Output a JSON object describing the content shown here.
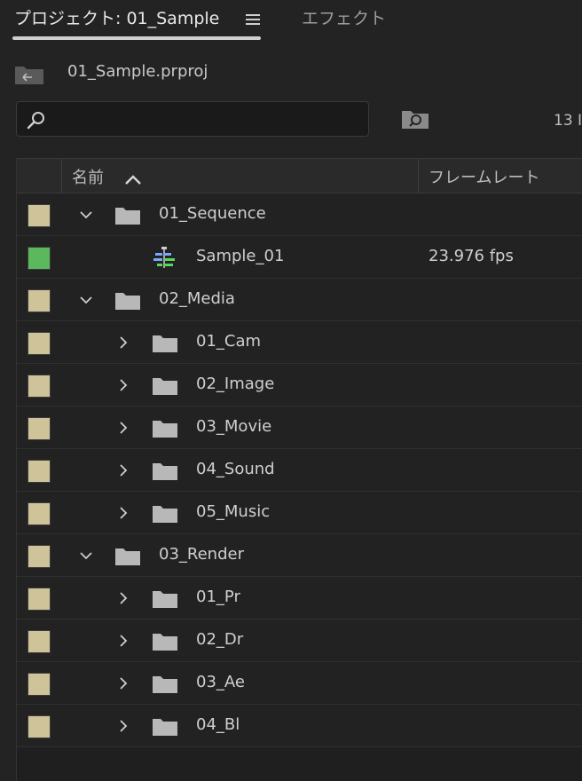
{
  "tabs": {
    "project_label": "プロジェクト: 01_Sample",
    "effects_label": "エフェクト"
  },
  "project": {
    "file_name": "01_Sample.prproj"
  },
  "search": {
    "value": "",
    "placeholder": ""
  },
  "item_count": "13 I",
  "columns": {
    "name": "名前",
    "frame_rate": "フレームレート"
  },
  "colors": {
    "folder_swatch": "#cfc39a",
    "sequence_swatch": "#5cb85c",
    "folder_icon": "#b8b8b8"
  },
  "rows": [
    {
      "label": "01_Sequence",
      "type": "bin",
      "expanded": true,
      "depth": 0,
      "rate": ""
    },
    {
      "label": "Sample_01",
      "type": "sequence",
      "expanded": false,
      "depth": 1,
      "rate": "23.976 fps"
    },
    {
      "label": "02_Media",
      "type": "bin",
      "expanded": true,
      "depth": 0,
      "rate": ""
    },
    {
      "label": "01_Cam",
      "type": "bin",
      "expanded": false,
      "depth": 1,
      "rate": ""
    },
    {
      "label": "02_Image",
      "type": "bin",
      "expanded": false,
      "depth": 1,
      "rate": ""
    },
    {
      "label": "03_Movie",
      "type": "bin",
      "expanded": false,
      "depth": 1,
      "rate": ""
    },
    {
      "label": "04_Sound",
      "type": "bin",
      "expanded": false,
      "depth": 1,
      "rate": ""
    },
    {
      "label": "05_Music",
      "type": "bin",
      "expanded": false,
      "depth": 1,
      "rate": ""
    },
    {
      "label": "03_Render",
      "type": "bin",
      "expanded": true,
      "depth": 0,
      "rate": ""
    },
    {
      "label": "01_Pr",
      "type": "bin",
      "expanded": false,
      "depth": 1,
      "rate": ""
    },
    {
      "label": "02_Dr",
      "type": "bin",
      "expanded": false,
      "depth": 1,
      "rate": ""
    },
    {
      "label": "03_Ae",
      "type": "bin",
      "expanded": false,
      "depth": 1,
      "rate": ""
    },
    {
      "label": "04_Bl",
      "type": "bin",
      "expanded": false,
      "depth": 1,
      "rate": ""
    }
  ]
}
